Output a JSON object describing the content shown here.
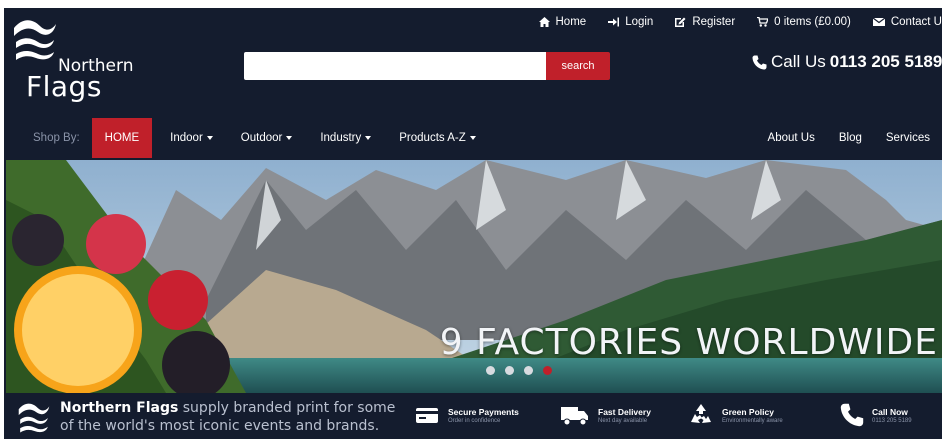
{
  "brand": {
    "line1": "Northern",
    "line2": "Flags"
  },
  "top_links": [
    {
      "id": "home",
      "label": "Home",
      "icon": "home-icon"
    },
    {
      "id": "login",
      "label": "Login",
      "icon": "login-icon"
    },
    {
      "id": "register",
      "label": "Register",
      "icon": "edit-icon"
    },
    {
      "id": "cart",
      "label": "0 items (£0.00)",
      "icon": "cart-icon"
    },
    {
      "id": "contact",
      "label": "Contact U",
      "icon": "envelope-icon"
    }
  ],
  "search": {
    "value": "",
    "placeholder": "",
    "button_label": "search"
  },
  "call_us": {
    "prefix": "Call Us",
    "number": "0113 205 5189"
  },
  "nav": {
    "shop_by": "Shop By:",
    "items": [
      {
        "label": "HOME",
        "active": true,
        "dropdown": false
      },
      {
        "label": "Indoor",
        "active": false,
        "dropdown": true
      },
      {
        "label": "Outdoor",
        "active": false,
        "dropdown": true
      },
      {
        "label": "Industry",
        "active": false,
        "dropdown": true
      },
      {
        "label": "Products A-Z",
        "active": false,
        "dropdown": true
      }
    ],
    "right_items": [
      {
        "label": "About Us"
      },
      {
        "label": "Blog"
      },
      {
        "label": "Services"
      }
    ]
  },
  "hero": {
    "headline": "9 FACTORIES WORLDWIDE",
    "slide_count": 4,
    "active_slide": 4
  },
  "strip": {
    "brand": "Northern Flags",
    "tagline": " supply branded print for some of the world's most iconic events and brands.",
    "features": [
      {
        "title": "Secure Payments",
        "subtitle": "Order in confidence",
        "icon": "card-icon"
      },
      {
        "title": "Fast Delivery",
        "subtitle": "Next day available",
        "icon": "truck-icon"
      },
      {
        "title": "Green Policy",
        "subtitle": "Environmentally aware",
        "icon": "recycle-icon"
      },
      {
        "title": "Call Now",
        "subtitle": "0113 205 5189",
        "icon": "phone-icon"
      }
    ]
  },
  "colors": {
    "navy": "#141c2e",
    "accent_red": "#c0202a",
    "muted": "#8a93a8"
  }
}
